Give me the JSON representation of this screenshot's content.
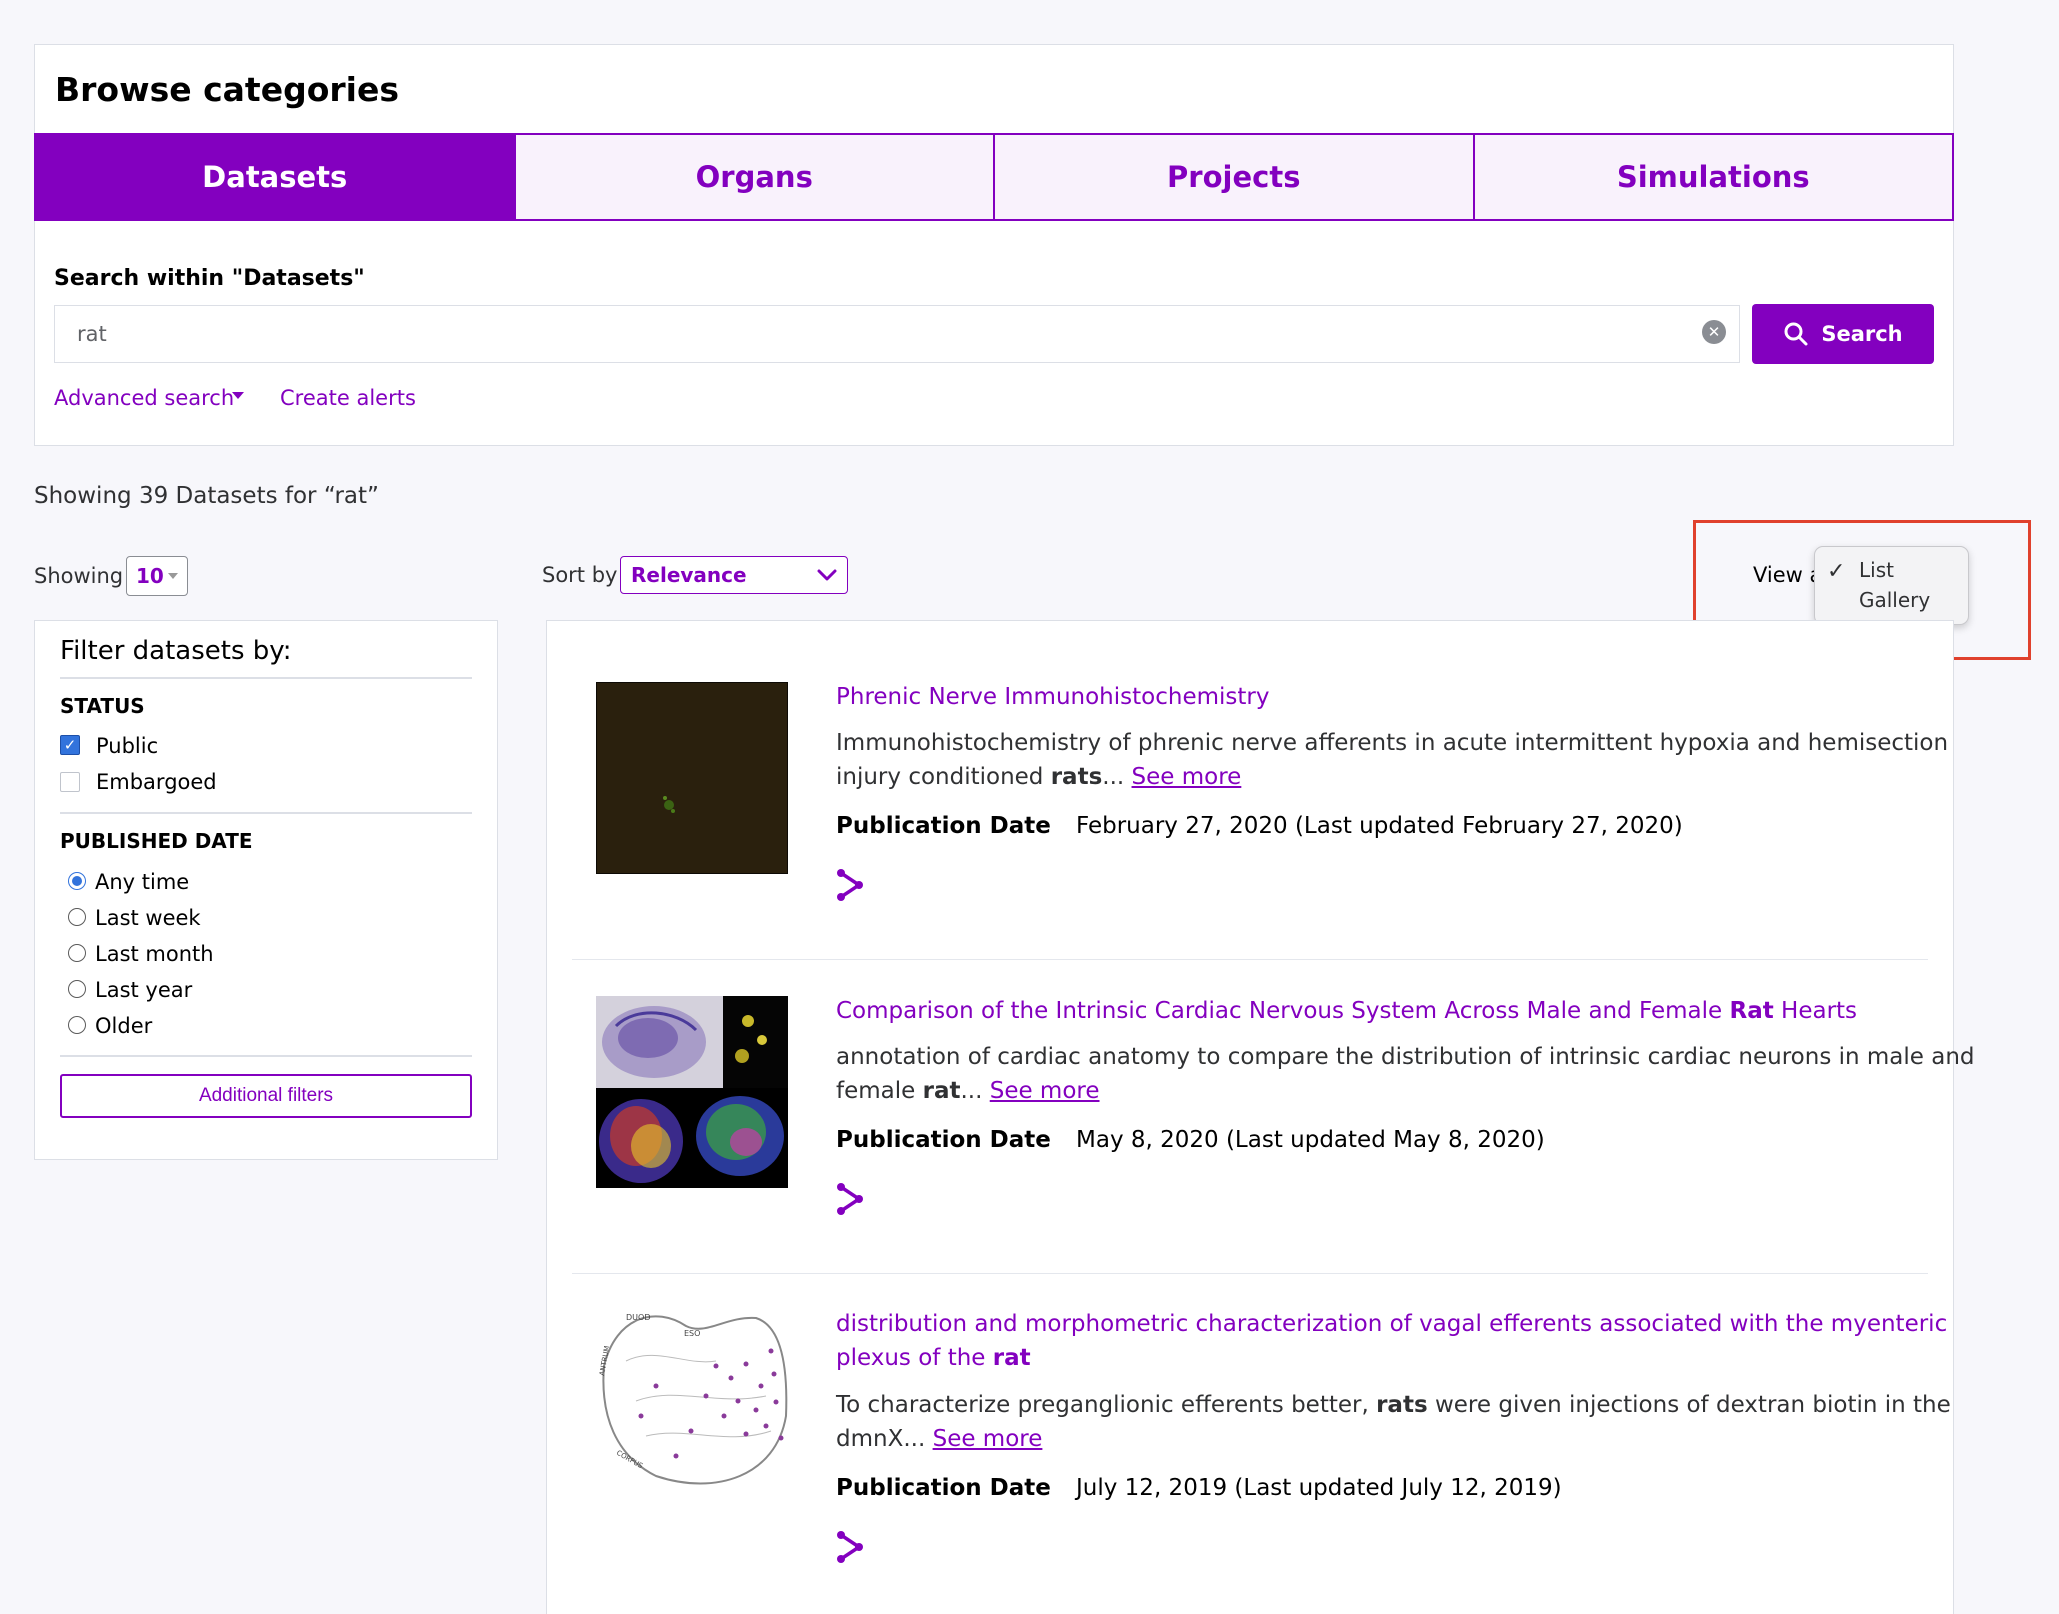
{
  "header": {
    "title": "Browse categories"
  },
  "tabs": [
    {
      "label": "Datasets",
      "active": true
    },
    {
      "label": "Organs",
      "active": false
    },
    {
      "label": "Projects",
      "active": false
    },
    {
      "label": "Simulations",
      "active": false
    }
  ],
  "search": {
    "label": "Search within \"Datasets\"",
    "value": "rat",
    "button_label": "Search",
    "advanced_label": "Advanced search",
    "alerts_label": "Create alerts"
  },
  "results_summary": "Showing 39 Datasets for “rat”",
  "controls": {
    "showing_label": "Showing",
    "page_size": "10",
    "sort_label": "Sort by",
    "sort_value": "Relevance",
    "view_label": "View a",
    "view_options": [
      {
        "label": "List",
        "checked": true
      },
      {
        "label": "Gallery",
        "checked": false
      }
    ],
    "check_mark": "✓"
  },
  "filters": {
    "title": "Filter datasets by:",
    "status": {
      "heading": "STATUS",
      "options": [
        {
          "label": "Public",
          "checked": true
        },
        {
          "label": "Embargoed",
          "checked": false
        }
      ]
    },
    "published": {
      "heading": "PUBLISHED DATE",
      "options": [
        {
          "label": "Any time",
          "selected": true
        },
        {
          "label": "Last week",
          "selected": false
        },
        {
          "label": "Last month",
          "selected": false
        },
        {
          "label": "Last year",
          "selected": false
        },
        {
          "label": "Older",
          "selected": false
        }
      ]
    },
    "additional_label": "Additional filters"
  },
  "results": [
    {
      "title": "Phrenic Nerve Immunohistochemistry",
      "desc_line1": "Immunohistochemistry of phrenic nerve afferents in acute intermittent hypoxia and hemisection",
      "desc_line2_pre": "injury conditioned ",
      "desc_line2_bold": "rats",
      "desc_line2_post": "...",
      "see_more": "See more",
      "pub_label": "Publication Date",
      "pub_value": "February 27, 2020 (Last updated February 27, 2020)"
    },
    {
      "title_pre": "Comparison of the Intrinsic Cardiac Nervous System Across Male and Female ",
      "title_bold": "Rat",
      "title_post": " Hearts",
      "desc_line1": "annotation of cardiac anatomy to compare the distribution of intrinsic cardiac neurons in male and",
      "desc_line2_pre": "female ",
      "desc_line2_bold": "rat",
      "desc_line2_post": "...",
      "see_more": "See more",
      "pub_label": "Publication Date",
      "pub_value": "May 8, 2020 (Last updated May 8, 2020)"
    },
    {
      "title_line1": "distribution and morphometric characterization of vagal efferents associated with the myenteric",
      "title_line2_pre": "plexus of the ",
      "title_line2_bold": "rat",
      "desc_line1_pre": "To characterize preganglionic efferents better, ",
      "desc_line1_bold": "rats",
      "desc_line1_post": " were given injections of dextran biotin in the",
      "desc_line2_pre": "dmnX...",
      "see_more": "See more",
      "pub_label": "Publication Date",
      "pub_value": "July 12, 2019 (Last updated July 12, 2019)",
      "thumb_labels": [
        "DUOD",
        "ESO",
        "ANTRUM",
        "CORPUS"
      ]
    }
  ],
  "colors": {
    "accent": "#8300bf",
    "highlight": "#e0412d",
    "checkbox": "#3273dc"
  }
}
